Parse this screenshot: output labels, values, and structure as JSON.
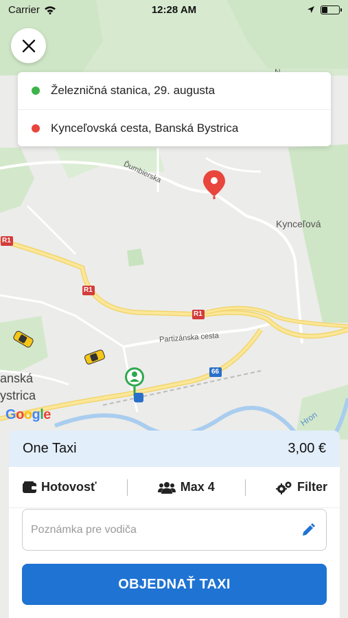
{
  "status": {
    "carrier": "Carrier",
    "time": "12:28 AM"
  },
  "route": {
    "pickup": "Železničná stanica, 29. augusta",
    "destination": "Kynceľovská cesta, Banská Bystrica",
    "pickup_color": "#3db34a",
    "destination_color": "#e8453c"
  },
  "map": {
    "labels": {
      "dumbierska": "Ďumbierska",
      "kyncelova": "Kynceľová",
      "partizanska": "Partizánska cesta",
      "banska": "anská",
      "bystrica": "ystrica",
      "hron": "Hron",
      "r1_a": "R1",
      "r1_b": "R1",
      "r1_c": "R1",
      "road66": "66",
      "n": "N"
    },
    "google": "Google",
    "pickup_marker_color": "#2fa84f",
    "destination_marker_color": "#e8453c"
  },
  "panel": {
    "service_name": "One Taxi",
    "price": "3,00 €",
    "payment_label": "Hotovosť",
    "capacity_label": "Max 4",
    "filter_label": "Filter",
    "note_placeholder": "Poznámka pre vodiča",
    "note_value": "",
    "order_label": "OBJEDNAŤ TAXI",
    "accent": "#1f73d2"
  }
}
